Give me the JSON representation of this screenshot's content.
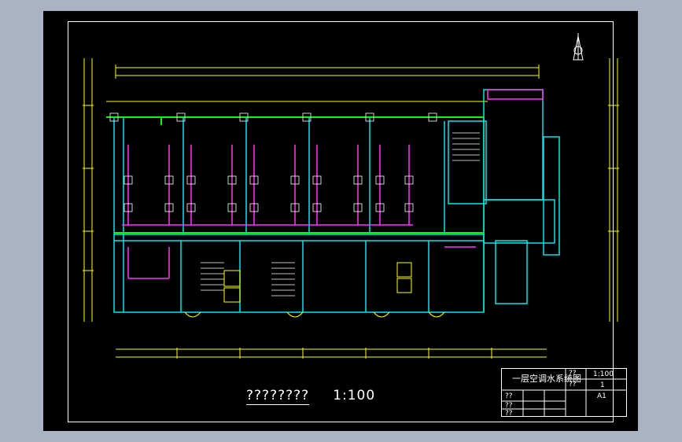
{
  "drawing": {
    "title": "????????",
    "scale": "1:100",
    "colors": {
      "background": "#000000",
      "wall": "#00e6e6",
      "pipe_supply": "#00ff00",
      "pipe_return": "#ff33ff",
      "dimension": "#ffff00",
      "annotation": "#ffffff",
      "outer_gray": "#a9b3c4"
    }
  },
  "title_block": {
    "drawing_name": "一层空调水系统图",
    "label_a": "??",
    "label_b": "??",
    "label_c": "??",
    "label_d": "??",
    "label_e": "??",
    "scale_value": "1:100",
    "sheet_value": "1",
    "size_value": "A1"
  },
  "north_arrow": {
    "symbol": "north-arrow",
    "letter": "N"
  }
}
